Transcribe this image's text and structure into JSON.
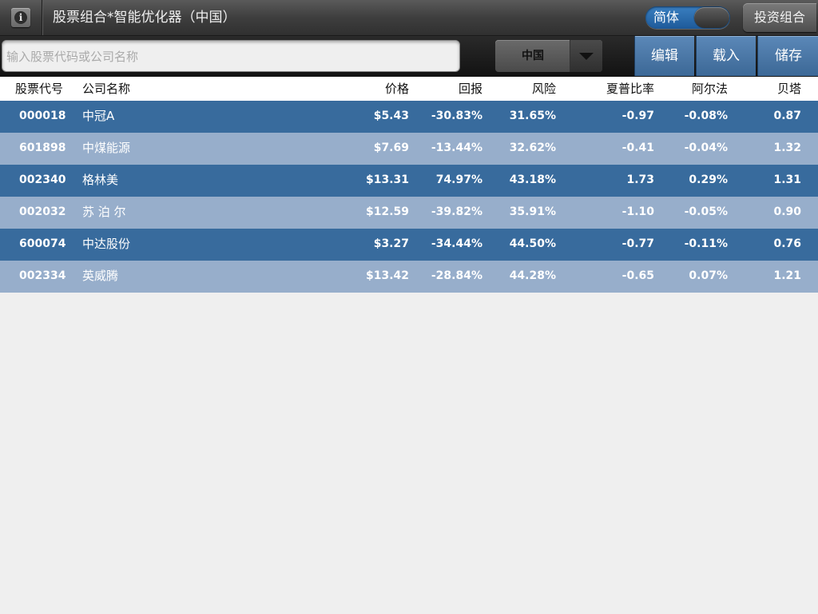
{
  "app": {
    "title": "股票组合*智能优化器（中国）",
    "language_toggle_label": "简体",
    "portfolio_button": "投资组合"
  },
  "toolbar": {
    "search_placeholder": "输入股票代码或公司名称",
    "country": "中国",
    "edit_label": "编辑",
    "load_label": "载入",
    "save_label": "储存"
  },
  "table": {
    "headers": {
      "code": "股票代号",
      "name": "公司名称",
      "price": "价格",
      "return": "回报",
      "risk": "风险",
      "sharpe": "夏普比率",
      "alpha": "阿尔法",
      "beta": "贝塔"
    },
    "rows": [
      {
        "code": "000018",
        "name": "中冠A",
        "price": "$5.43",
        "return": "-30.83%",
        "risk": "31.65%",
        "sharpe": "-0.97",
        "alpha": "-0.08%",
        "beta": "0.87"
      },
      {
        "code": "601898",
        "name": "中煤能源",
        "price": "$7.69",
        "return": "-13.44%",
        "risk": "32.62%",
        "sharpe": "-0.41",
        "alpha": "-0.04%",
        "beta": "1.32"
      },
      {
        "code": "002340",
        "name": "格林美",
        "price": "$13.31",
        "return": "74.97%",
        "risk": "43.18%",
        "sharpe": "1.73",
        "alpha": "0.29%",
        "beta": "1.31"
      },
      {
        "code": "002032",
        "name": "苏 泊 尔",
        "price": "$12.59",
        "return": "-39.82%",
        "risk": "35.91%",
        "sharpe": "-1.10",
        "alpha": "-0.05%",
        "beta": "0.90"
      },
      {
        "code": "600074",
        "name": "中达股份",
        "price": "$3.27",
        "return": "-34.44%",
        "risk": "44.50%",
        "sharpe": "-0.77",
        "alpha": "-0.11%",
        "beta": "0.76"
      },
      {
        "code": "002334",
        "name": "英威腾",
        "price": "$13.42",
        "return": "-28.84%",
        "risk": "44.28%",
        "sharpe": "-0.65",
        "alpha": "0.07%",
        "beta": "1.21"
      }
    ]
  },
  "colors": {
    "row_dark": "#386b9d",
    "row_light": "#97aecb",
    "toolbar_button": "#4a78a8",
    "toggle_on": "#2a6cb0"
  }
}
